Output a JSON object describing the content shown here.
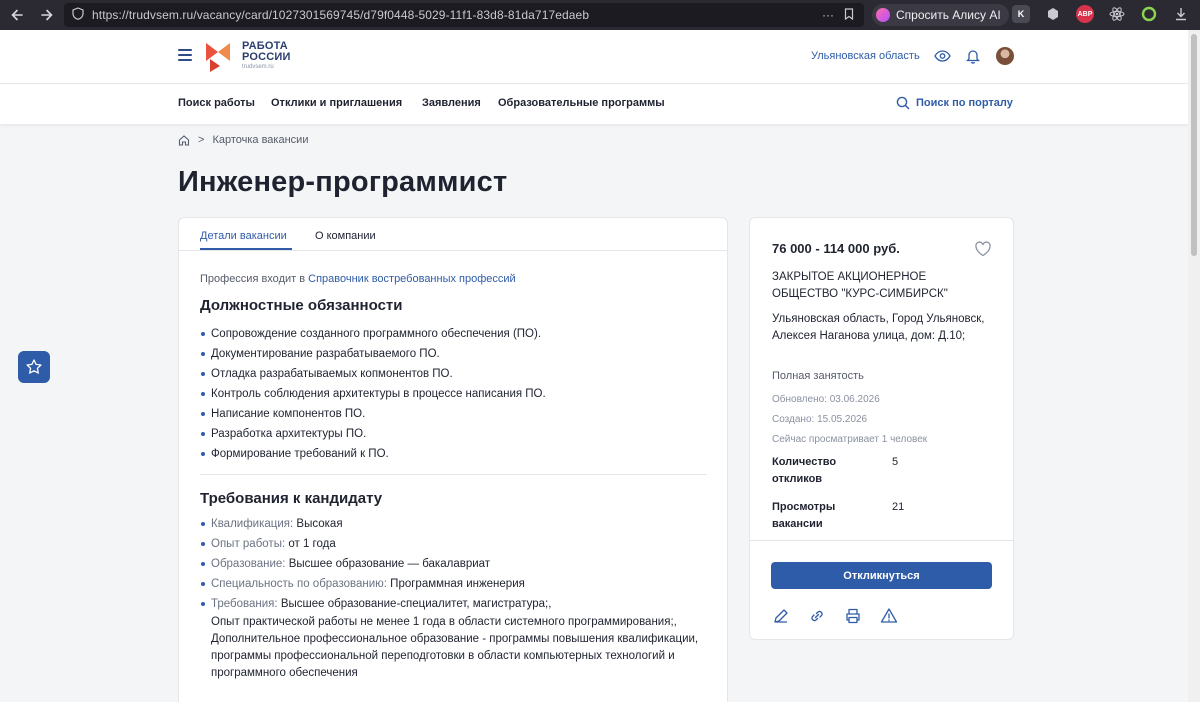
{
  "browser": {
    "url": "https://trudvsem.ru/vacancy/card/1027301569745/d79f0448-5029-11f1-83d8-81da717edaeb",
    "alice_label": "Спросить Алису AI",
    "ext_abp": "ABP"
  },
  "header": {
    "logo_line1": "РАБОТА",
    "logo_line2": "РОССИИ",
    "logo_line3": "trudvsem.ru",
    "region": "Ульяновская область"
  },
  "nav": {
    "items": [
      "Поиск работы",
      "Отклики и приглашения",
      "Заявления",
      "Образовательные программы"
    ],
    "portal_search": "Поиск по порталу"
  },
  "breadcrumb": {
    "separator": ">",
    "current": "Карточка вакансии"
  },
  "page_title": "Инженер-программист",
  "tabs": [
    "Детали вакансии",
    "О компании"
  ],
  "profession": {
    "prefix": "Профессия входит в",
    "link": "Справочник востребованных профессий"
  },
  "duties": {
    "title": "Должностные обязанности",
    "items": [
      "Сопровождение созданного программного обеспечения (ПО).",
      "Документирование разрабатываемого ПО.",
      "Отладка разрабатываемых копмонентов ПО.",
      "Контроль соблюдения архитектуры в процессе написания ПО.",
      "Написание компонентов ПО.",
      "Разработка архитектуры ПО.",
      "Формирование требований к ПО."
    ]
  },
  "requirements": {
    "title": "Требования к кандидату",
    "items": [
      {
        "label": "Квалификация:",
        "value": "Высокая"
      },
      {
        "label": "Опыт работы:",
        "value": "от 1 года"
      },
      {
        "label": "Образование:",
        "value": "Высшее образование — бакалавриат"
      },
      {
        "label": "Специальность по образованию:",
        "value": "Программная инженерия"
      },
      {
        "label": "Требования:",
        "value": "Высшее образование-специалитет, магистратура;,"
      }
    ],
    "extra_lines": [
      "Опыт практической работы не менее 1 года в области системного программирования;,",
      "Дополнительное профессиональное образование - программы повышения квалификации, программы профессиональной переподготовки в области компьютерных технологий и программного обеспечения"
    ]
  },
  "vacancy": {
    "salary": "76 000 - 114 000 руб.",
    "company": "ЗАКРЫТОЕ АКЦИОНЕРНОЕ ОБЩЕСТВО \"КУРС-СИМБИРСК\"",
    "address": "Ульяновская область, Город Ульяновск, Алексея Наганова улица, дом: Д.10;",
    "employment": "Полная занятость",
    "updated": "Обновлено: 03.06.2026",
    "created": "Создано: 15.05.2026",
    "viewing_now": "Сейчас просматривает 1 человек",
    "responses_label": "Количество откликов",
    "responses_value": "5",
    "views_label": "Просмотры вакансии",
    "views_value": "21",
    "respond_button": "Откликнуться"
  },
  "colors": {
    "brand_blue": "#2f5ca8",
    "logo_orange": "#e8523f",
    "title_text": "#1f2330"
  }
}
